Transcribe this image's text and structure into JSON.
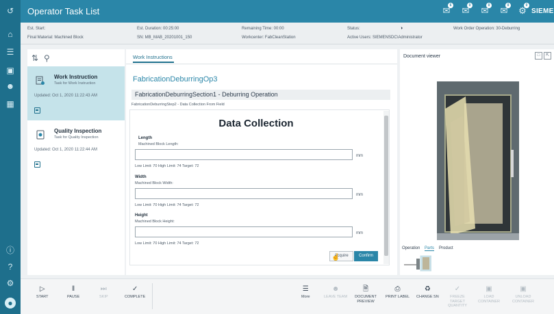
{
  "app": {
    "title": "Operator Task List",
    "brand": "SIEMENS"
  },
  "rail": {
    "icons": [
      "back-icon",
      "home-icon",
      "layers-icon",
      "monitor-icon",
      "people-icon",
      "dashboard-icon",
      "info-icon",
      "help-icon",
      "settings-icon",
      "user-icon"
    ]
  },
  "topbar": {
    "badges": [
      "6",
      "0",
      "0",
      "0",
      "0"
    ]
  },
  "info": {
    "est_start": "Est. Start:",
    "final_material": "Final Material: Machined Block",
    "est_duration": "Est. Duration: 00:25:00",
    "sn": "SN: MB_MAB_20201001_150",
    "remaining_time": "Remaining Time: 00:00",
    "workcenter": "Workcenter: FabCleanStation",
    "status": "Status:",
    "active_users": "Active Users: SIEMENSDC\\Administrator",
    "work_order_operation": "Work Order Operation: 30-Deburring"
  },
  "tasks": [
    {
      "title": "Work Instruction",
      "subtitle": "Task for Work Instruction",
      "updated": "Updated: Oct 1, 2020 11:22:43 AM",
      "selected": true
    },
    {
      "title": "Quality Inspection",
      "subtitle": "Task for Quality Inspection",
      "updated": "Updated: Oct 1, 2020 11:22:44 AM",
      "selected": false
    }
  ],
  "center": {
    "tab_label": "Work Instructions",
    "operation_title": "FabricationDeburringOp3",
    "section_title": "FabricationDeburringSection1 - Deburring Operation",
    "step_title": "FabricationDeburringStep2 - Data Collection From Field",
    "form_heading": "Data Collection",
    "fields": [
      {
        "label": "Length",
        "sublabel": "Machined Block Length:",
        "value": "",
        "unit": "mm",
        "limits": "Low Limit: 70   High Limit: 74   Target: 72"
      },
      {
        "label": "Width",
        "sublabel": "Machined Block Width:",
        "value": "",
        "unit": "mm",
        "limits": "Low Limit: 70   High Limit: 74   Target: 72"
      },
      {
        "label": "Height",
        "sublabel": "Machined Block Height:",
        "value": "",
        "unit": "mm",
        "limits": "Low Limit: 70   High Limit: 74   Target: 72"
      }
    ],
    "acquire_label": "Acquire",
    "confirm_label": "Confirm"
  },
  "viewer": {
    "title": "Document viewer",
    "tabs": [
      "Operation",
      "Parts",
      "Product"
    ],
    "active_tab": "Parts"
  },
  "bottom": {
    "start": "START",
    "pause": "PAUSE",
    "skip": "SKIP",
    "complete": "COMPLETE",
    "more": "More",
    "leave_team": "LEAVE TEAM",
    "document_preview": "DOCUMENT PREVIEW",
    "print_label": "PRINT LABEL",
    "change_sn": "CHANGE SN",
    "freeze_target_quantity": "FREEZE TARGET QUANTITY",
    "load_container": "LOAD CONTAINER",
    "unload_container": "UNLOAD CONTAINER"
  },
  "colors": {
    "rail": "#1e6f8c",
    "topbar": "#2a86a8",
    "selected_task": "#c5e3ea",
    "accent": "#2a86a8"
  }
}
